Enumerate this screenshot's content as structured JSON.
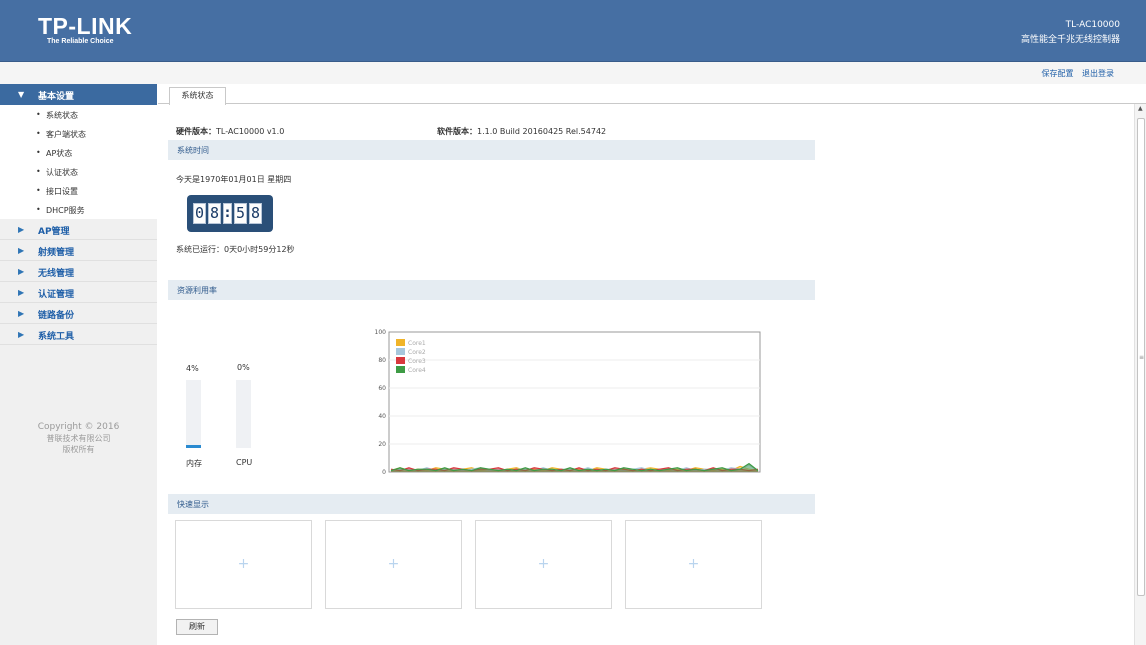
{
  "header": {
    "logo_brand": "TP-LINK",
    "logo_slogan": "The Reliable Choice",
    "model_name": "TL-AC10000",
    "model_desc": "高性能全千兆无线控制器"
  },
  "toplinks": {
    "save": "保存配置",
    "logout": "退出登录"
  },
  "sidebar": {
    "groups": [
      {
        "label": "基本设置",
        "open": true,
        "items": [
          "系统状态",
          "客户端状态",
          "AP状态",
          "认证状态",
          "接口设置",
          "DHCP服务"
        ]
      },
      {
        "label": "AP管理"
      },
      {
        "label": "射频管理"
      },
      {
        "label": "无线管理"
      },
      {
        "label": "认证管理"
      },
      {
        "label": "链路备份"
      },
      {
        "label": "系统工具"
      }
    ],
    "copyright": {
      "line1": "Copyright © 2016",
      "line2": "普联技术有限公司",
      "line3": "版权所有"
    }
  },
  "tab": "系统状态",
  "info": {
    "hw_label": "硬件版本：",
    "hw_value": "TL-AC10000 v1.0",
    "sw_label": "软件版本：",
    "sw_value": "1.1.0 Build 20160425 Rel.54742"
  },
  "system_time": {
    "title": "系统时间",
    "date_text": "今天是1970年01月01日 星期四",
    "clock": [
      "0",
      "8",
      ":",
      "5",
      "8"
    ],
    "uptime": "系统已运行：0天0小时59分12秒"
  },
  "resource": {
    "title": "资源利用率",
    "mem_pct": "4%",
    "mem_value": 4,
    "mem_label": "内存",
    "cpu_pct": "0%",
    "cpu_value": 0,
    "cpu_label": "CPU"
  },
  "chart_data": {
    "type": "area",
    "title": "",
    "xlabel": "",
    "ylabel": "",
    "ylim": [
      0,
      100
    ],
    "yticks": [
      0,
      20,
      40,
      60,
      80,
      100
    ],
    "grid": true,
    "legend_position": "top-left",
    "series": [
      {
        "name": "Core1",
        "color": "#f0b429",
        "values": [
          1,
          3,
          1,
          2,
          1,
          3,
          2,
          1,
          2,
          3,
          1,
          2,
          1,
          2,
          3,
          1,
          2,
          1,
          3,
          2,
          1,
          2,
          1,
          3,
          2,
          1,
          2,
          1,
          2,
          3,
          2,
          1,
          2,
          1,
          3,
          2,
          1,
          2,
          1,
          4,
          2,
          1
        ]
      },
      {
        "name": "Core2",
        "color": "#a7c7dc",
        "values": [
          1,
          2,
          2,
          1,
          3,
          1,
          2,
          2,
          1,
          2,
          3,
          1,
          2,
          1,
          2,
          2,
          1,
          3,
          1,
          2,
          2,
          1,
          3,
          1,
          2,
          2,
          1,
          2,
          3,
          1,
          2,
          2,
          1,
          3,
          1,
          2,
          2,
          1,
          3,
          2,
          5,
          1
        ]
      },
      {
        "name": "Core3",
        "color": "#d9373d",
        "values": [
          2,
          1,
          3,
          1,
          2,
          2,
          1,
          3,
          2,
          1,
          2,
          2,
          3,
          1,
          2,
          1,
          3,
          2,
          1,
          2,
          1,
          3,
          1,
          2,
          1,
          3,
          2,
          1,
          2,
          1,
          2,
          3,
          1,
          2,
          2,
          1,
          3,
          1,
          2,
          2,
          1,
          2
        ]
      },
      {
        "name": "Core4",
        "color": "#3e9b45",
        "values": [
          1,
          3,
          1,
          2,
          2,
          1,
          3,
          1,
          2,
          1,
          3,
          2,
          1,
          2,
          1,
          3,
          1,
          2,
          2,
          1,
          3,
          1,
          2,
          1,
          2,
          1,
          3,
          2,
          1,
          2,
          1,
          2,
          3,
          1,
          2,
          1,
          2,
          3,
          1,
          2,
          6,
          1
        ]
      }
    ]
  },
  "quick": {
    "title": "快速显示",
    "plus": "+",
    "count": 4
  },
  "refresh_label": "刷新"
}
